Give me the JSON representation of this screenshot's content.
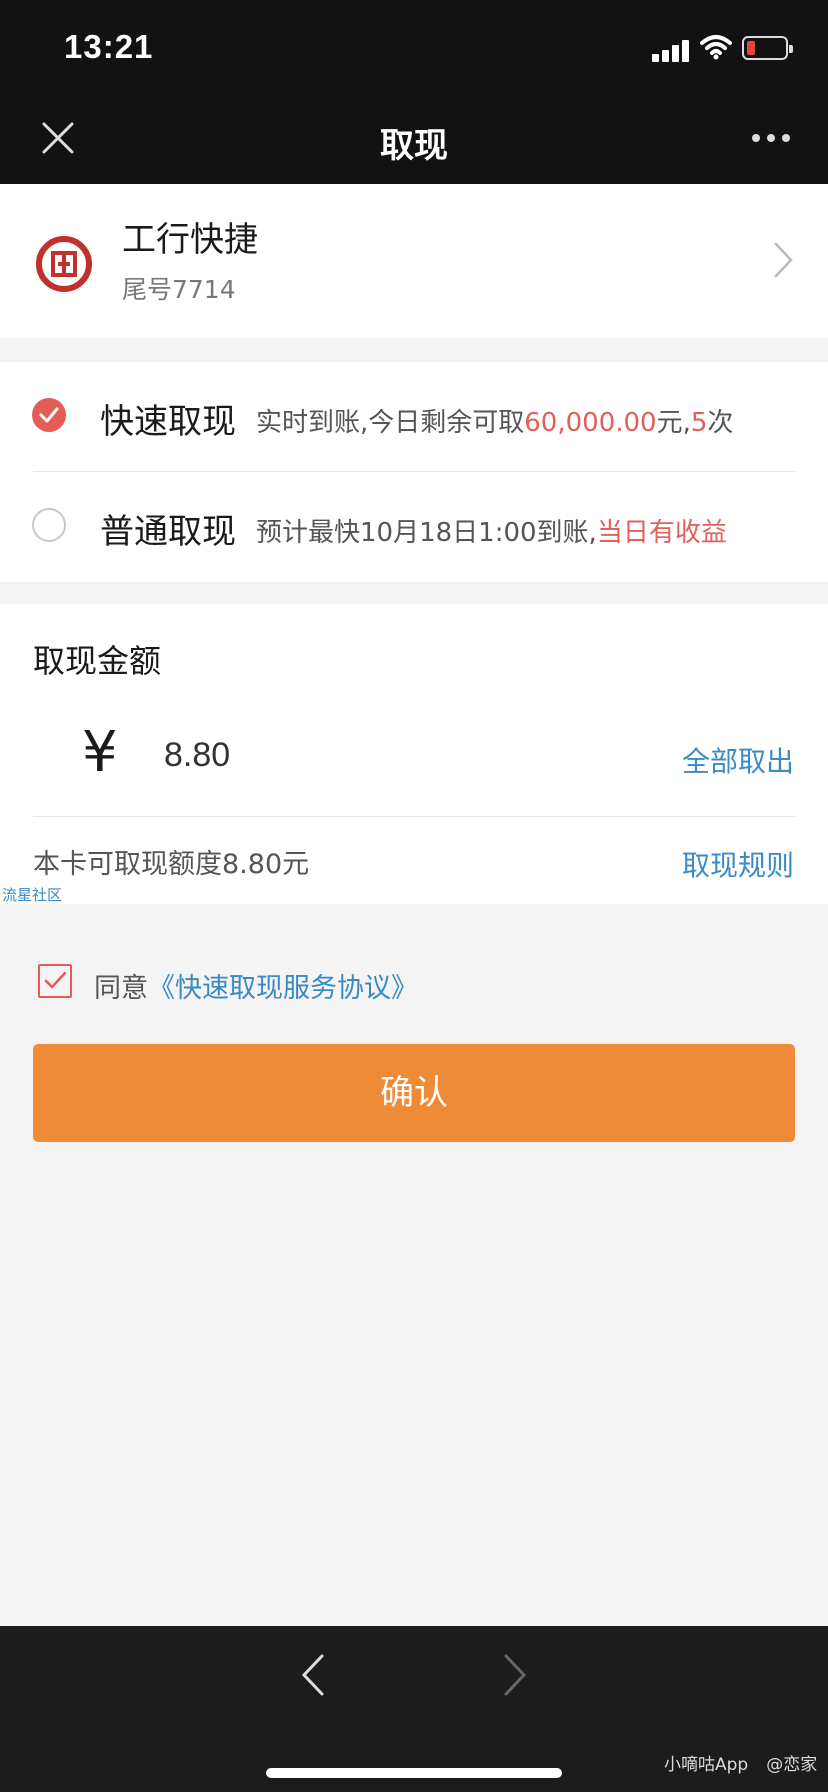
{
  "status_bar": {
    "time": "13:21"
  },
  "nav": {
    "title": "取现"
  },
  "bank": {
    "name": "工行快捷",
    "tail": "尾号7714"
  },
  "options": {
    "fast": {
      "title": "快速取现",
      "desc_prefix": "实时到账,今日剩余可取",
      "amount": "60,000.00",
      "desc_mid": "元,",
      "count": "5",
      "desc_suffix": "次",
      "selected": true
    },
    "normal": {
      "title": "普通取现",
      "desc_prefix": "预计最快10月18日1:00到账,",
      "highlight": "当日有收益",
      "selected": false
    }
  },
  "amount": {
    "label": "取现金额",
    "currency": "¥",
    "value": "8.80",
    "withdraw_all": "全部取出",
    "limit_text": "本卡可取现额度8.80元",
    "rules": "取现规则"
  },
  "watermark": "流星社区",
  "agreement": {
    "prefix": "同意",
    "link": "《快速取现服务协议》",
    "checked": true
  },
  "confirm_label": "确认",
  "footer_credit": {
    "app": "小嘀咕App",
    "author": "@恋家"
  },
  "colors": {
    "accent_orange": "#ef8a36",
    "accent_red": "#e35c58",
    "link_blue": "#3a8ac4"
  }
}
